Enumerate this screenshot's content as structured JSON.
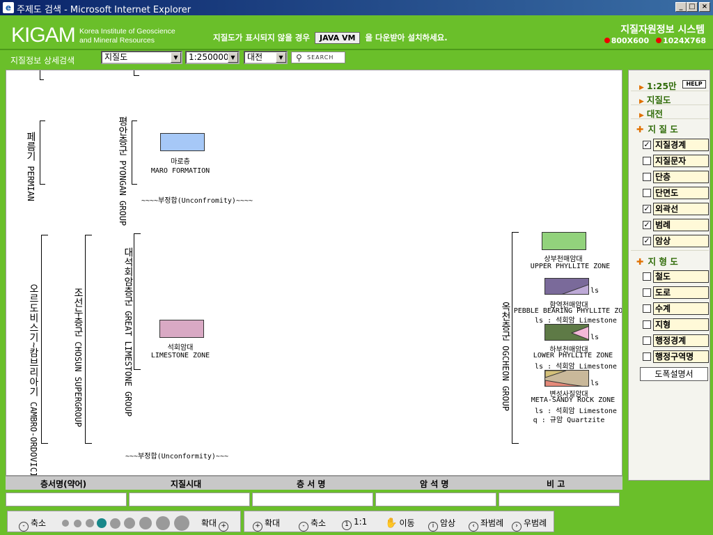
{
  "window": {
    "title": "주제도 검색 - Microsoft Internet Explorer",
    "btn_min": "_",
    "btn_max": "□",
    "btn_close": "×"
  },
  "header": {
    "logo": "KIGAM",
    "logo_sub1": "Korea Institute of Geoscience",
    "logo_sub2": "and Mineral Resources",
    "java_msg_pre": "지질도가 표시되지 않을 경우",
    "java_btn": "JAVA VM",
    "java_msg_post": "을 다운받아 설치하세요.",
    "system_name": "지질자원정보 시스템",
    "res1": "800X600",
    "res2": "1024X768"
  },
  "toolbar": {
    "label": "지질정보 상세검색",
    "map_type": "지질도",
    "scale": "1:250000",
    "region": "대전",
    "search": "SEARCH"
  },
  "legend": {
    "permian": {
      "ko": "페름기",
      "en": "PERMIAN"
    },
    "pyongan": {
      "ko": "평안층군",
      "en": "PYONGAN GROUP"
    },
    "maro": {
      "ko": "마로층",
      "en": "MARO FORMATION",
      "color": "#a6c8f7"
    },
    "unconf1": "~~~~부정합(Unconfromity)~~~~",
    "cambro": {
      "ko": "오르도비스기~캄브리아기",
      "en": "CAMBRO-ORDOVICIAN"
    },
    "choson": {
      "ko": "조선누층군",
      "en": "CHOSUN SUPERGROUP"
    },
    "great": {
      "ko": "대석회암층군",
      "en": "GREAT LIMESTONE GROUP"
    },
    "limestone": {
      "ko": "석회암대",
      "en": "LIMESTONE ZONE",
      "color": "#d9a9c4"
    },
    "unconf2": "~~~부정합(Unconformity)~~~",
    "ogcheon": {
      "ko": "옥천층군",
      "en": "OGCHEON GROUP"
    },
    "upper": {
      "ko": "상부천매암대",
      "en": "UPPER PHYLLITE ZONE",
      "color": "#92d27c"
    },
    "pebble": {
      "ko": "함역천매암대",
      "en": "PEBBLE BEARING PHYLLITE ZONE",
      "ls": "ls : 석회암 Limestone",
      "color": "#7a6a9a"
    },
    "lower": {
      "ko": "하부천매암대",
      "en": "LOWER PHYLLITE ZONE",
      "ls": "ls : 석회암 Limestone",
      "color": "#5e7a46"
    },
    "meta": {
      "ko": "변성사질암대",
      "en": "META-SANDY ROCK ZONE",
      "ls": "ls : 석회암 Limestone",
      "q": "q : 규암 Quartzite",
      "color": "#c9b89a"
    },
    "ls_tag": "ls"
  },
  "table": {
    "headers": [
      "층서명(약어)",
      "지질시대",
      "층 서 명",
      "암 석 명",
      "비  고"
    ]
  },
  "bottom": {
    "shrink": "축소",
    "enlarge": "확대",
    "zoom_in": "확대",
    "zoom_out": "축소",
    "one_to_one": "1:1",
    "pan": "이동",
    "rock": "암상",
    "left_legend": "좌범례",
    "right_legend": "우범례"
  },
  "right": {
    "scale": "1:25만",
    "help": "HELP",
    "map_type": "지질도",
    "region": "대전",
    "geo_section": "지 질 도",
    "geo_layers": [
      {
        "label": "지질경계",
        "checked": true
      },
      {
        "label": "지질문자",
        "checked": false
      },
      {
        "label": "단층",
        "checked": false
      },
      {
        "label": "단면도",
        "checked": false
      },
      {
        "label": "외곽선",
        "checked": true
      },
      {
        "label": "범례",
        "checked": true
      },
      {
        "label": "암상",
        "checked": true
      }
    ],
    "topo_section": "지 형 도",
    "topo_layers": [
      {
        "label": "철도",
        "checked": false
      },
      {
        "label": "도로",
        "checked": false
      },
      {
        "label": "수계",
        "checked": false
      },
      {
        "label": "지형",
        "checked": false
      },
      {
        "label": "행정경계",
        "checked": false
      },
      {
        "label": "행정구역명",
        "checked": false
      }
    ],
    "description_btn": "도폭설명서"
  }
}
